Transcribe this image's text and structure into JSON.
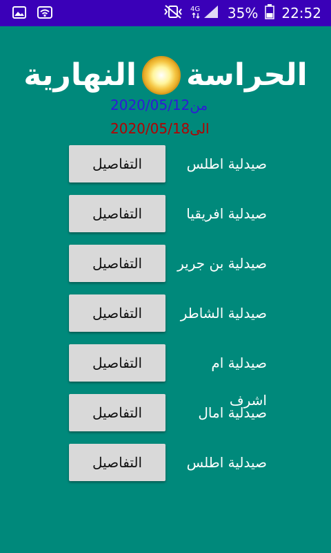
{
  "status_bar": {
    "battery_percent": "35%",
    "time": "22:52",
    "network": "4G"
  },
  "header": {
    "title_left": "الحراسة",
    "title_right": "النهارية",
    "from_label": "من",
    "from_date": "2020/05/12",
    "to_label": "الى",
    "to_date": "2020/05/18"
  },
  "pharmacies": [
    {
      "name": "صيدلية اطلس",
      "button_label": "التفاصيل"
    },
    {
      "name": "صيدلية افريقيا",
      "button_label": "التفاصيل"
    },
    {
      "name": "صيدلية بن جرير",
      "button_label": "التفاصيل"
    },
    {
      "name": "صيدلية الشاطر",
      "button_label": "التفاصيل"
    },
    {
      "name": "صيدلية ام اشرف",
      "button_label": "التفاصيل"
    },
    {
      "name": "صيدلية امال",
      "button_label": "التفاصيل"
    },
    {
      "name": "صيدلية اطلس",
      "button_label": "التفاصيل"
    }
  ],
  "colors": {
    "background": "#00897b",
    "status_bar": "#3a00b8",
    "from_date": "#2f19d8",
    "to_date": "#b30000",
    "button": "#d9d9d9"
  }
}
